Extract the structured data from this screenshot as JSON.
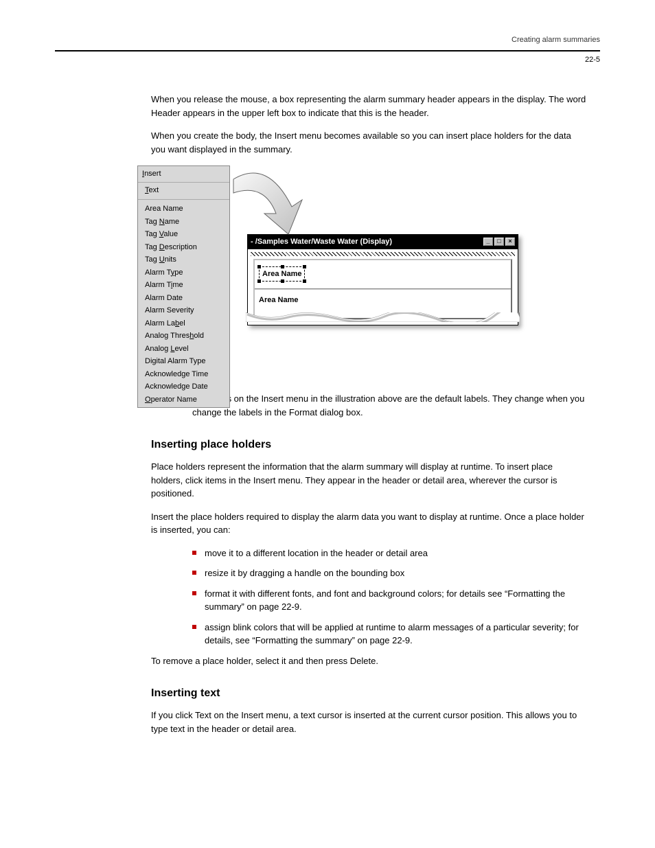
{
  "header": {
    "chapter": "Creating alarm summaries",
    "page": "22-5"
  },
  "body": {
    "p1": "When you release the mouse, a box representing the alarm summary header appears in the display. The word Header appears in the upper left box to indicate that this is the header.",
    "p2": "When you create the body, the Insert menu becomes available so you can insert place holders for the data you want displayed in the summary.",
    "note": "The items on the Insert menu in the illustration above are the default labels. They change when you change the labels in the Format dialog box.",
    "h_insert": "Inserting place holders",
    "p3": "Place holders represent the information that the alarm summary will display at runtime. To insert place holders, click items in the Insert menu. They appear in the header or detail area, wherever the cursor is positioned.",
    "p4": "Insert the place holders required to display the alarm data you want to display at runtime. Once a place holder is inserted, you can:",
    "b1": "move it to a different location in the header or detail area",
    "b2": "resize it by dragging a handle on the bounding box",
    "b3": "format it with different fonts, and font and background colors; for details see “Formatting the summary” on page 22-9.",
    "b4": "assign blink colors that will be applied at runtime to alarm messages of a particular severity; for details, see “Formatting the summary” on page 22-9.",
    "p5": "To remove a place holder, select it and then press Delete.",
    "h_text": "Inserting text",
    "p6": "If you click Text on the Insert menu, a text cursor is inserted at the current cursor position. This allows you to type text in the header or detail area."
  },
  "menu": {
    "title": "Insert",
    "items_text": "Text",
    "i1": "Area Name",
    "i2": "Tag Name",
    "i3": "Tag Value",
    "i4": "Tag Description",
    "i5": "Tag Units",
    "i6": "Alarm Type",
    "i7": "Alarm Time",
    "i8": "Alarm Date",
    "i9": "Alarm Severity",
    "i10": "Alarm Label",
    "i11": "Analog Threshold",
    "i12": "Analog Level",
    "i13": "Digital Alarm Type",
    "i14": "Acknowledge Time",
    "i15": "Acknowledge Date",
    "i16": "Operator Name"
  },
  "window": {
    "title": "- /Samples Water/Waste Water (Display)",
    "header_ph": "Area Name",
    "detail_ph": "Area Name"
  }
}
